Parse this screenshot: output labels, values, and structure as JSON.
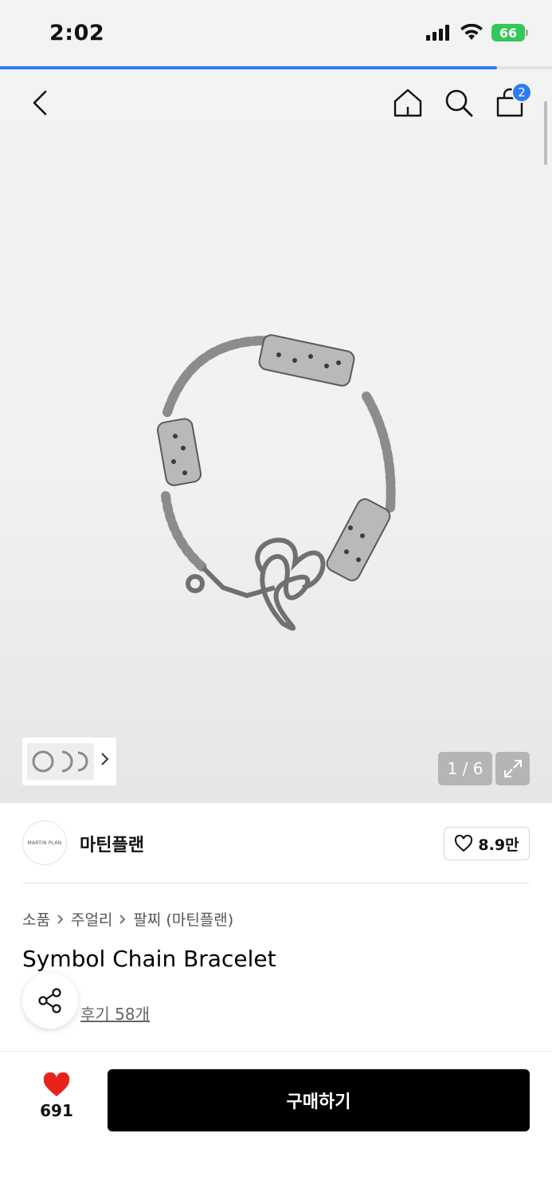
{
  "status_bar": {
    "time": "2:02",
    "battery": "66"
  },
  "hero": {
    "page_indicator": "1 / 6",
    "loading_progress": 0.9
  },
  "nav": {
    "cart_count": "2"
  },
  "brand": {
    "logo_text": "MARTIN PLAN",
    "name": "마틴플랜",
    "likes": "8.9만"
  },
  "breadcrumb": [
    "소품",
    "주얼리",
    "팔찌 (마틴플랜)"
  ],
  "product": {
    "title": "Symbol Chain Bracelet",
    "reviews": "후기 58개"
  },
  "bottom_bar": {
    "like_count": "691",
    "buy_label": "구매하기"
  },
  "colors": {
    "accent": "#2f7bf5",
    "heart": "#e8231b",
    "battery": "#34c759",
    "buy_button": "#000000"
  },
  "icons": [
    "back-icon",
    "home-icon",
    "search-icon",
    "cart-icon",
    "expand-icon",
    "heart-outline-icon",
    "share-icon",
    "heart-icon"
  ]
}
